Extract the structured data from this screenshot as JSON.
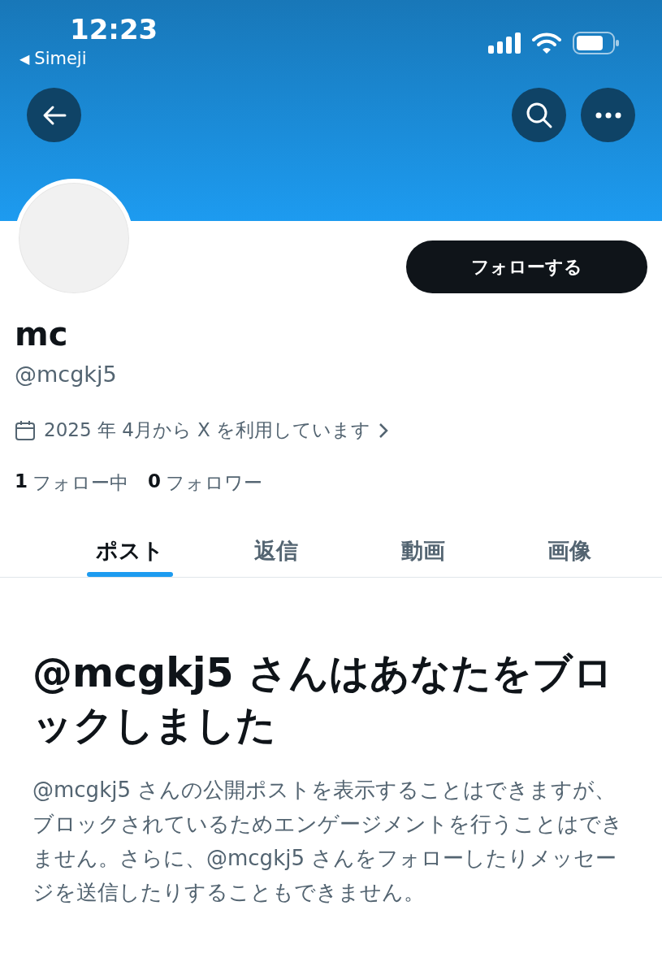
{
  "status_bar": {
    "time": "12:23",
    "back_arrow": "◀",
    "back_app": "Simeji"
  },
  "profile": {
    "name": "mc",
    "handle": "@mcgkj5",
    "follow_button": "フォローする",
    "joined": "2025 年 4月から X を利用しています",
    "stats": [
      {
        "count": "1",
        "label": "フォロー中"
      },
      {
        "count": "0",
        "label": "フォロワー"
      }
    ]
  },
  "tabs": [
    {
      "label": "ポスト",
      "selected": true
    },
    {
      "label": "返信",
      "selected": false
    },
    {
      "label": "動画",
      "selected": false
    },
    {
      "label": "画像",
      "selected": false
    }
  ],
  "blocked": {
    "title": "@mcgkj5 さんはあなたをブロックしました",
    "message": "@mcgkj5 さんの公開ポストを表示することはできますが、ブロックされているためエンゲージメントを行うことはできません。さらに、@mcgkj5 さんをフォローしたりメッセージを送信したりすることもできません。"
  }
}
